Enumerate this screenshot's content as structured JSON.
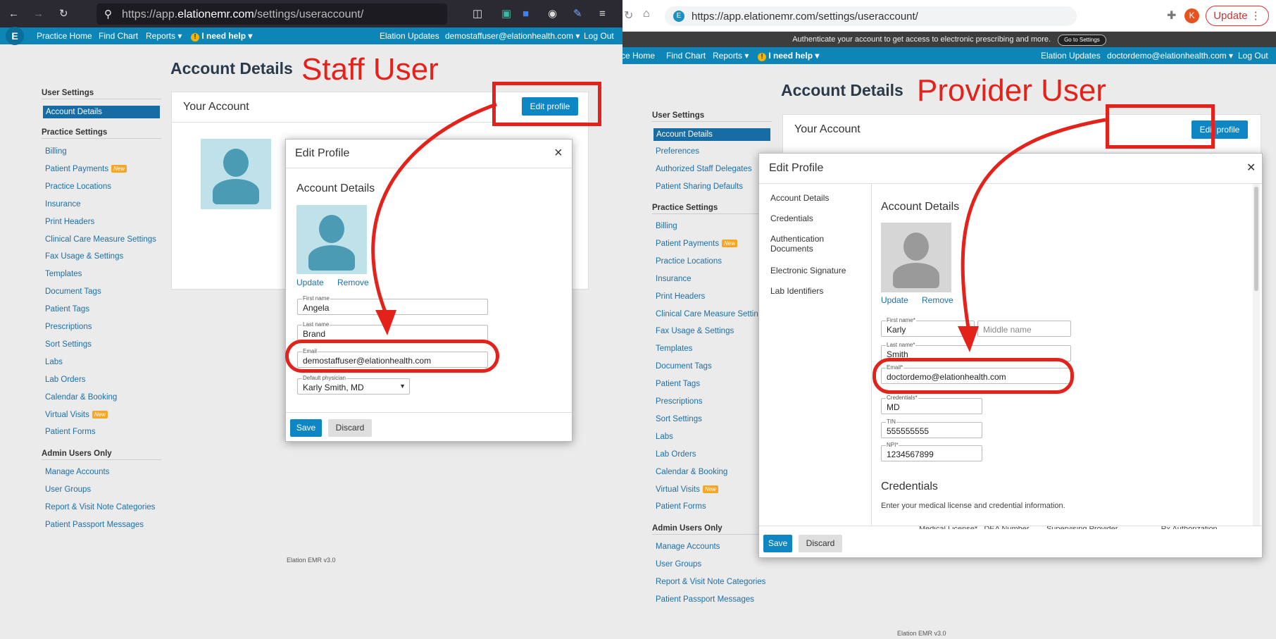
{
  "left": {
    "browser": {
      "url_pre": "https://app.",
      "url_domain": "elationemr.com",
      "url_post": "/settings/useraccount/"
    },
    "nav": {
      "practice_home": "Practice Home",
      "find_chart": "Find Chart",
      "reports": "Reports ▾",
      "help": "I need help ▾",
      "updates": "Elation Updates",
      "user": "demostaffuser@elationhealth.com ▾",
      "logout": "Log Out"
    },
    "page_title": "Account Details",
    "label": "Staff User",
    "sidebar": {
      "user_settings": "User Settings",
      "account_details": "Account Details",
      "practice_settings": "Practice Settings",
      "practice_items": [
        "Billing",
        "Patient Payments",
        "Practice Locations",
        "Insurance",
        "Print Headers",
        "Clinical Care Measure Settings",
        "Fax Usage & Settings",
        "Templates",
        "Document Tags",
        "Patient Tags",
        "Prescriptions",
        "Sort Settings",
        "Labs",
        "Lab Orders",
        "Calendar & Booking",
        "Virtual Visits",
        "Patient Forms"
      ],
      "admin_header": "Admin Users Only",
      "admin_items": [
        "Manage Accounts",
        "User Groups",
        "Report & Visit Note Categories",
        "Patient Passport Messages"
      ],
      "new_badge": "New"
    },
    "card": {
      "title": "Your Account",
      "edit_profile": "Edit profile"
    },
    "modal": {
      "title": "Edit Profile",
      "close": "×",
      "section": "Account Details",
      "update": "Update",
      "remove": "Remove",
      "first_name_label": "First name",
      "first_name": "Angela",
      "last_name_label": "Last name",
      "last_name": "Brand",
      "email_label": "Email",
      "email": "demostaffuser@elationhealth.com",
      "physician_label": "Default physician",
      "physician": "Karly Smith, MD",
      "save": "Save",
      "discard": "Discard"
    },
    "version": "Elation EMR v3.0"
  },
  "right": {
    "browser": {
      "url": "https://app.elationemr.com/settings/useraccount/",
      "update": "Update",
      "avatar_letter": "K"
    },
    "auth_banner": "Authenticate your account to get access to electronic prescribing and more.",
    "auth_button": "Go to Settings",
    "nav": {
      "practice_home": "ce Home",
      "find_chart": "Find Chart",
      "reports": "Reports ▾",
      "help": "I need help ▾",
      "updates": "Elation Updates",
      "user": "doctordemo@elationhealth.com ▾",
      "logout": "Log Out"
    },
    "page_title": "Account Details",
    "label": "Provider User",
    "sidebar": {
      "user_settings": "User Settings",
      "account_details": "Account Details",
      "user_items": [
        "Preferences",
        "Authorized Staff Delegates",
        "Patient Sharing Defaults"
      ],
      "practice_settings": "Practice Settings",
      "practice_items": [
        "Billing",
        "Patient Payments",
        "Practice Locations",
        "Insurance",
        "Print Headers",
        "Clinical Care Measure Settings",
        "Fax Usage & Settings",
        "Templates",
        "Document Tags",
        "Patient Tags",
        "Prescriptions",
        "Sort Settings",
        "Labs",
        "Lab Orders",
        "Calendar & Booking",
        "Virtual Visits",
        "Patient Forms"
      ],
      "admin_header": "Admin Users Only",
      "admin_items": [
        "Manage Accounts",
        "User Groups",
        "Report & Visit Note Categories",
        "Patient Passport Messages"
      ],
      "new_badge": "New"
    },
    "card": {
      "title": "Your Account",
      "edit_profile": "Edit profile"
    },
    "modal": {
      "title": "Edit Profile",
      "close": "✕",
      "tabs": [
        "Account Details",
        "Credentials",
        "Authentication Documents",
        "Electronic Signature",
        "Lab Identifiers"
      ],
      "section": "Account Details",
      "update": "Update",
      "remove": "Remove",
      "first_name_label": "First name*",
      "first_name": "Karly",
      "middle_placeholder": "Middle name",
      "last_name_label": "Last name*",
      "last_name": "Smith",
      "email_label": "Email*",
      "email": "doctordemo@elationhealth.com",
      "credentials_label": "Credentials*",
      "credentials": "MD",
      "tin_label": "TIN",
      "tin": "555555555",
      "npi_label": "NPI*",
      "npi": "1234567899",
      "cred_section": "Credentials",
      "cred_desc": "Enter your medical license and credential information.",
      "cred_cols": "Medical License*   DEA Number        Supervising Provider                    Rx Authorization",
      "save": "Save",
      "discard": "Discard"
    },
    "version": "Elation EMR v3.0"
  },
  "colors": {
    "nav": "#0d86b7",
    "accent_red": "#e3231b",
    "button_blue": "#0d86c3"
  }
}
